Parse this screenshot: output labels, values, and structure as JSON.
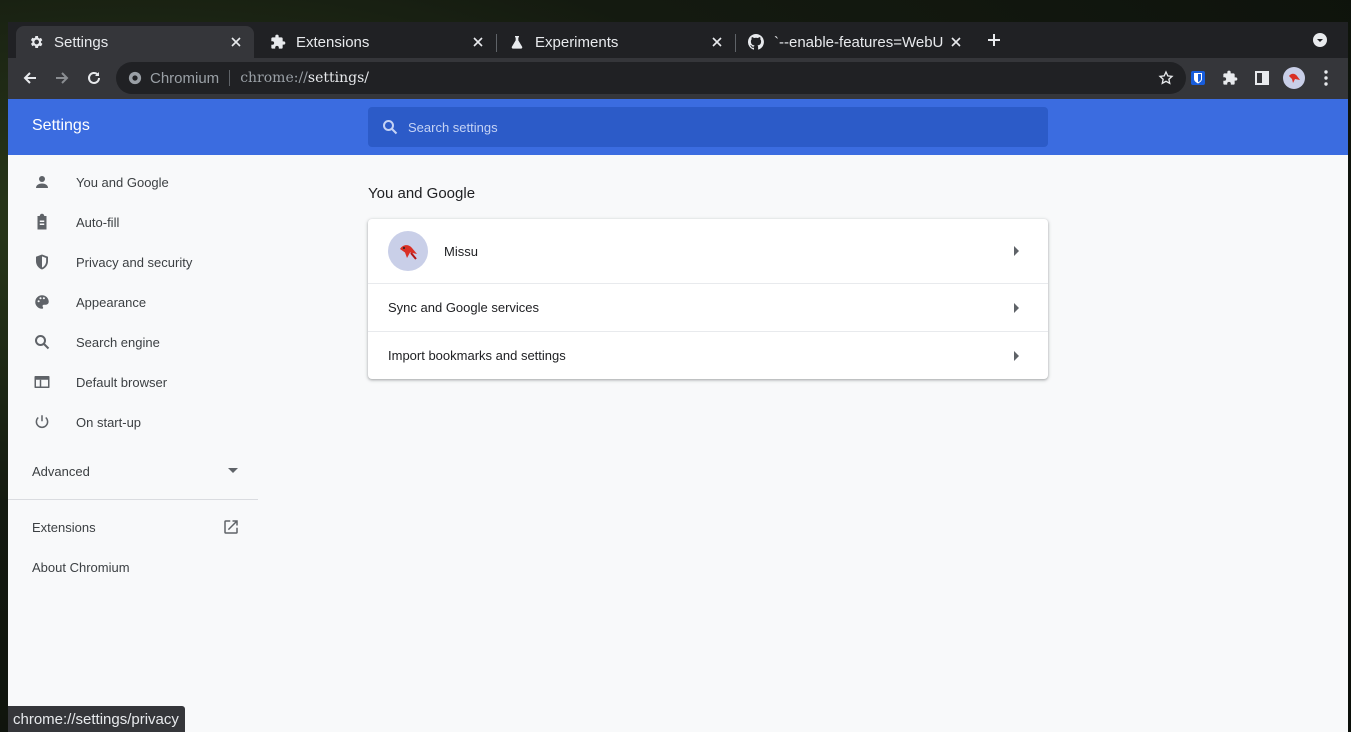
{
  "tabs": [
    {
      "title": "Settings",
      "icon": "gear-icon",
      "active": true
    },
    {
      "title": "Extensions",
      "icon": "puzzle-icon",
      "active": false
    },
    {
      "title": "Experiments",
      "icon": "flask-icon",
      "active": false
    },
    {
      "title": "`--enable-features=WebU",
      "icon": "github-icon",
      "active": false
    }
  ],
  "omnibox": {
    "site": "Chromium",
    "url_scheme": "chrome://",
    "url_path": "settings/"
  },
  "settings": {
    "title": "Settings",
    "search_placeholder": "Search settings",
    "sidebar": [
      {
        "label": "You and Google",
        "icon": "person-icon"
      },
      {
        "label": "Auto-fill",
        "icon": "clipboard-icon"
      },
      {
        "label": "Privacy and security",
        "icon": "shield-icon"
      },
      {
        "label": "Appearance",
        "icon": "palette-icon"
      },
      {
        "label": "Search engine",
        "icon": "search-icon"
      },
      {
        "label": "Default browser",
        "icon": "browser-icon"
      },
      {
        "label": "On start-up",
        "icon": "power-icon"
      }
    ],
    "advanced_label": "Advanced",
    "extensions_label": "Extensions",
    "about_label": "About Chromium",
    "section_title": "You and Google",
    "card": {
      "profile_name": "Missu",
      "sync_label": "Sync and Google services",
      "import_label": "Import bookmarks and settings"
    }
  },
  "status_url": "chrome://settings/privacy",
  "colors": {
    "header": "#3b6ce0",
    "search": "#2c5bc8",
    "icon": "#5f6368"
  }
}
